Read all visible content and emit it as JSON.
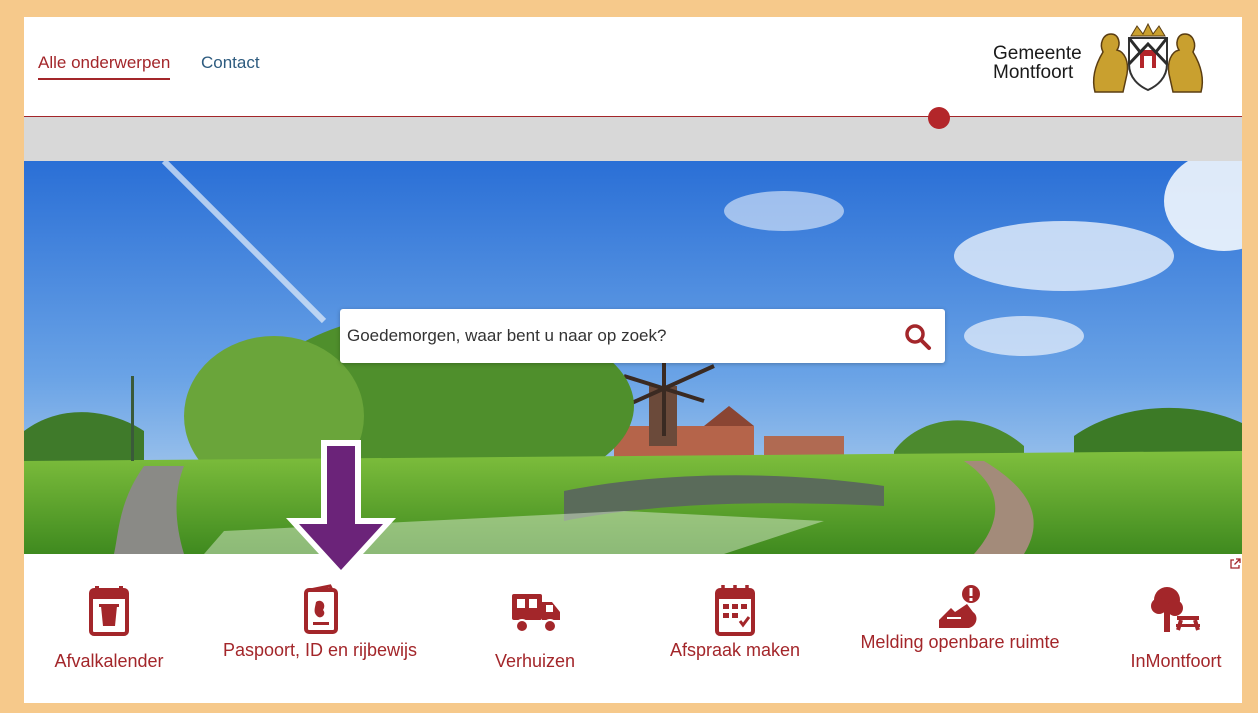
{
  "nav": {
    "items": [
      {
        "label": "Alle onderwerpen",
        "active": true
      },
      {
        "label": "Contact",
        "active": false
      }
    ]
  },
  "logo": {
    "line1": "Gemeente",
    "line2": "Montfoort"
  },
  "search": {
    "placeholder": "Goedemorgen, waar bent u naar op zoek?"
  },
  "tiles": [
    {
      "label": "Afvalkalender",
      "icon": "calendar-bin-icon"
    },
    {
      "label": "Paspoort, ID en rijbewijs",
      "icon": "passport-icon"
    },
    {
      "label": "Verhuizen",
      "icon": "moving-truck-icon"
    },
    {
      "label": "Afspraak maken",
      "icon": "calendar-check-icon"
    },
    {
      "label": "Melding openbare ruimte",
      "icon": "report-public-space-icon"
    },
    {
      "label": "InMontfoort",
      "icon": "tree-bench-icon"
    }
  ],
  "colors": {
    "brand": "#a3262a",
    "nav_link": "#2d5b7f",
    "annotation_arrow": "#6b2379",
    "frame": "#f6c98b"
  }
}
